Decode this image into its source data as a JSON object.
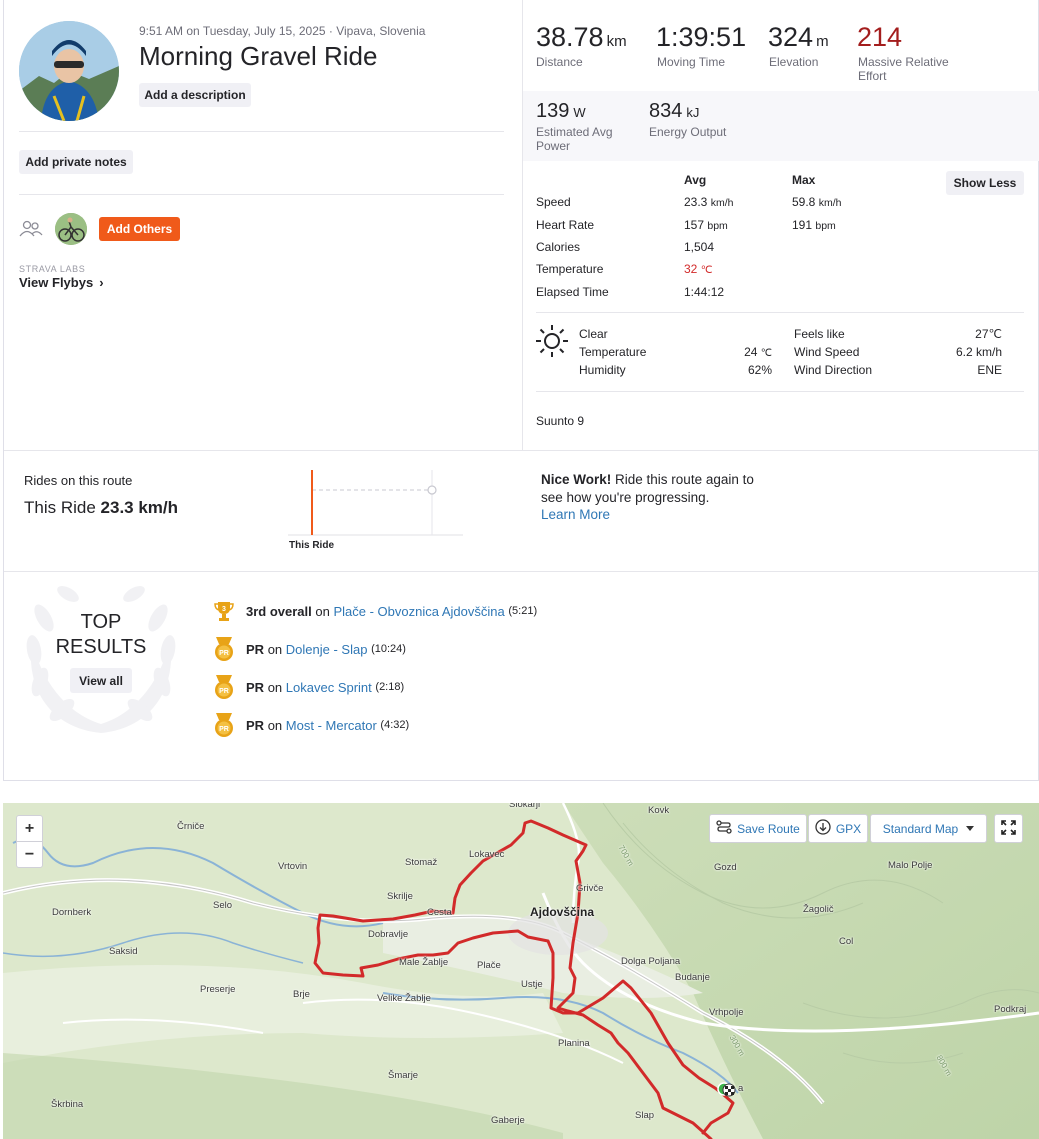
{
  "activity": {
    "datetime_location": "9:51 AM on Tuesday, July 15, 2025 · Vipava, Slovenia",
    "title": "Morning Gravel Ride",
    "add_description": "Add a description",
    "add_private_notes": "Add private notes",
    "add_others": "Add Others",
    "strava_labs": "STRAVA LABS",
    "view_flybys": "View Flybys"
  },
  "stats": {
    "distance": {
      "value": "38.78",
      "unit": "km",
      "label": "Distance"
    },
    "moving_time": {
      "value": "1:39:51",
      "label": "Moving Time"
    },
    "elevation": {
      "value": "324",
      "unit": "m",
      "label": "Elevation"
    },
    "effort": {
      "value": "214",
      "label_1": "Massive Relative",
      "label_2": "Effort"
    },
    "power": {
      "value": "139",
      "unit": "W",
      "label_1": "Estimated Avg",
      "label_2": "Power"
    },
    "energy": {
      "value": "834",
      "unit": "kJ",
      "label": "Energy Output"
    }
  },
  "details": {
    "avg_header": "Avg",
    "max_header": "Max",
    "show_less": "Show Less",
    "rows": [
      {
        "label": "Speed",
        "avg": "23.3",
        "avg_unit": "km/h",
        "max": "59.8",
        "max_unit": "km/h"
      },
      {
        "label": "Heart Rate",
        "avg": "157",
        "avg_unit": "bpm",
        "max": "191",
        "max_unit": "bpm"
      },
      {
        "label": "Calories",
        "avg": "1,504",
        "avg_unit": "",
        "max": "",
        "max_unit": ""
      },
      {
        "label": "Temperature",
        "avg": "32",
        "avg_unit": "℃",
        "max": "",
        "max_unit": ""
      },
      {
        "label": "Elapsed Time",
        "avg": "1:44:12",
        "avg_unit": "",
        "max": "",
        "max_unit": ""
      }
    ]
  },
  "weather": {
    "condition": "Clear",
    "temperature_label": "Temperature",
    "temperature_value": "24",
    "temperature_unit": "℃",
    "humidity_label": "Humidity",
    "humidity_value": "62%",
    "feels_like_label": "Feels like",
    "feels_like_value": "27℃",
    "wind_speed_label": "Wind Speed",
    "wind_speed_value": "6.2 km/h",
    "wind_direction_label": "Wind Direction",
    "wind_direction_value": "ENE"
  },
  "device": "Suunto 9",
  "route": {
    "title": "Rides on this route",
    "this_ride_prefix": "This Ride",
    "this_ride_speed": "23.3 km/h",
    "chart_label": "This Ride",
    "nice_work_bold": "Nice Work!",
    "nice_work_1": " Ride this route again to",
    "nice_work_2": "see how you're progressing.",
    "learn_more": "Learn More"
  },
  "top_results": {
    "title_1": "TOP",
    "title_2": "RESULTS",
    "view_all": "View all",
    "items": [
      {
        "badge": "3",
        "rank": "3rd overall",
        "on": "on",
        "segment": "Plače - Obvoznica Ajdovščina",
        "time": "(5:21)"
      },
      {
        "badge": "PR",
        "rank": "PR",
        "on": "on",
        "segment": "Dolenje - Slap",
        "time": "(10:24)"
      },
      {
        "badge": "PR",
        "rank": "PR",
        "on": "on",
        "segment": "Lokavec Sprint",
        "time": "(2:18)"
      },
      {
        "badge": "PR",
        "rank": "PR",
        "on": "on",
        "segment": "Most - Mercator",
        "time": "(4:32)"
      }
    ]
  },
  "map": {
    "zoom_in": "+",
    "zoom_out": "−",
    "save_route": "Save Route",
    "gpx": "GPX",
    "map_style": "Standard Map",
    "places": {
      "slokarji": "Slokarji",
      "kovk": "Kovk",
      "crnice": "Črniče",
      "lokavec": "Lokavec",
      "stomaz": "Stomaž",
      "vrtovin": "Vrtovin",
      "gozd": "Gozd",
      "malo_polje": "Malo Polje",
      "grivce": "Grivče",
      "skrilje": "Skrilje",
      "selo": "Selo",
      "dornberk": "Dornberk",
      "cesta": "Cesta",
      "ajdovscina": "Ajdovščina",
      "zagolic": "Žagolič",
      "dobravlje": "Dobravlje",
      "col": "Col",
      "saksid": "Saksid",
      "male_zablje": "Male Žablje",
      "place": "Plače",
      "dolga_poljana": "Dolga Poljana",
      "budanje": "Budanje",
      "preserje": "Preserje",
      "ustje": "Ustje",
      "brje": "Brje",
      "velike_zablje": "Velike Žablje",
      "vrhpolje": "Vrhpolje",
      "podkraj": "Podkraj",
      "planina": "Planina",
      "smarje": "Šmarje",
      "skrbina": "Škrbina",
      "slap": "Slap",
      "gaberje": "Gaberje",
      "vipava": "a",
      "c700": "700 m",
      "c300": "300 m",
      "c800": "800 m"
    }
  }
}
